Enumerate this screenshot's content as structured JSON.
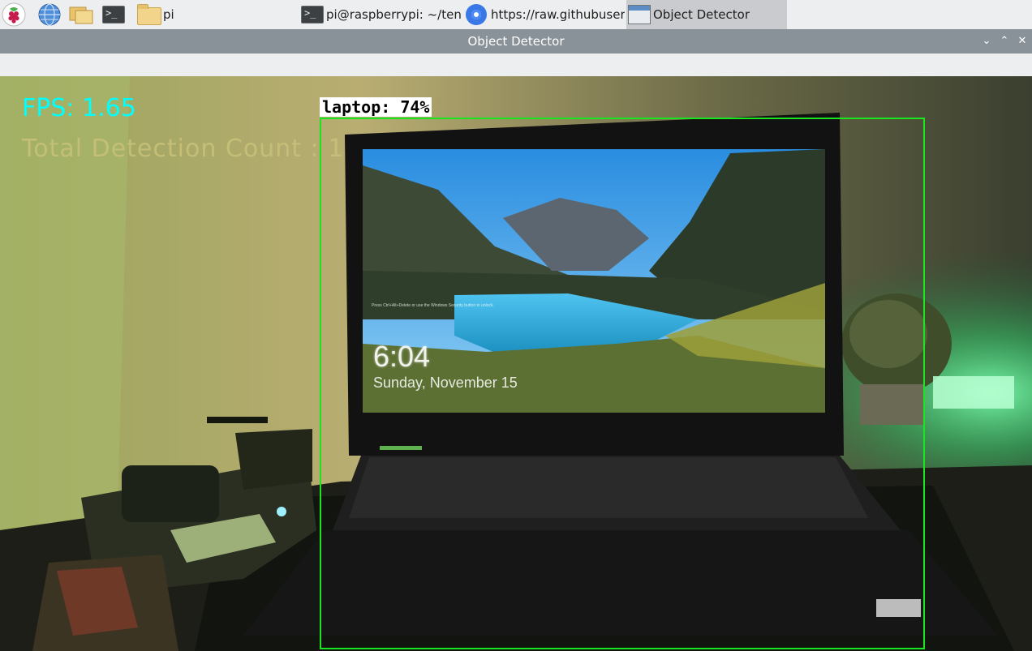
{
  "taskbar": {
    "launchers": [
      {
        "icon": "raspberry-menu-icon"
      },
      {
        "icon": "web-browser-icon"
      },
      {
        "icon": "file-manager-icon"
      },
      {
        "icon": "terminal-icon"
      }
    ],
    "tasks": [
      {
        "icon": "folder-icon",
        "label": "pi"
      },
      {
        "icon": "terminal-icon",
        "label": "pi@raspberrypi: ~/ten..."
      },
      {
        "icon": "chromium-icon",
        "label": "https://raw.githubuser..."
      },
      {
        "icon": "window-icon",
        "label": "Object Detector",
        "active": true
      }
    ]
  },
  "window": {
    "title": "Object Detector",
    "controls": {
      "minimize": "⌄",
      "maximize": "⌃",
      "close": "✕"
    }
  },
  "overlay": {
    "fps_text": "FPS: 1.65",
    "total_text": "Total Detection Count : 1",
    "detections": [
      {
        "label": "laptop: 74%",
        "color": "#19e61e"
      }
    ]
  },
  "laptop_screen": {
    "time": "6:04",
    "date": "Sunday, November 15",
    "notice": "Press Ctrl+Alt+Delete or use the Windows Security button to unlock."
  },
  "colors": {
    "fps": "#00ffff",
    "total": "#c9c27a",
    "box": "#19e61e",
    "titlebar": "#8a9299"
  }
}
